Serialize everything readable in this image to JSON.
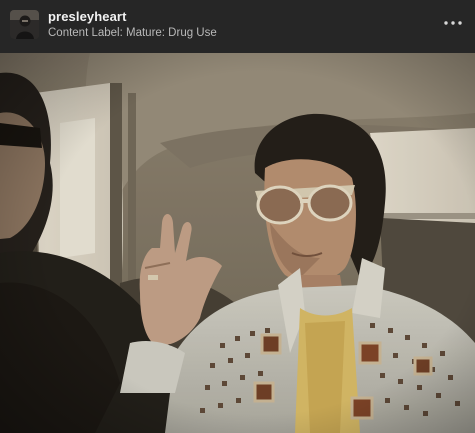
{
  "post": {
    "username": "presleyheart",
    "content_label": "Content Label: Mature: Drug Use",
    "avatar_icon": "user-avatar-icon",
    "more_icon": "more-dots-icon"
  },
  "colors": {
    "header_bg": "#262626",
    "username": "#f2f2f2",
    "label": "#b9b9b9"
  }
}
